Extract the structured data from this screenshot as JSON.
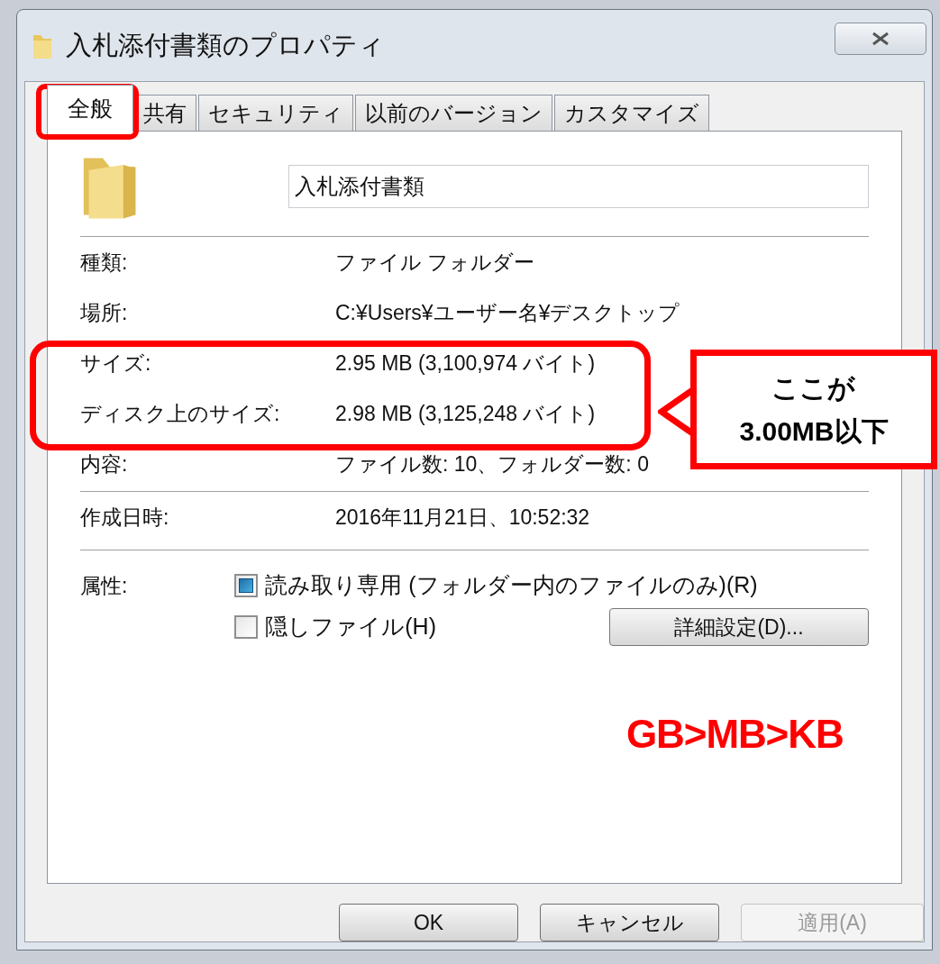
{
  "window": {
    "title": "入札添付書類のプロパティ"
  },
  "tabs": [
    {
      "label": "全般",
      "selected": true
    },
    {
      "label": "共有",
      "selected": false
    },
    {
      "label": "セキュリティ",
      "selected": false
    },
    {
      "label": "以前のバージョン",
      "selected": false
    },
    {
      "label": "カスタマイズ",
      "selected": false
    }
  ],
  "name_field": {
    "value": "入札添付書類"
  },
  "sections": [
    {
      "rows": [
        {
          "label": "種類:",
          "value": "ファイル フォルダー"
        },
        {
          "label": "場所:",
          "value": "C:¥Users¥ユーザー名¥デスクトップ"
        },
        {
          "label": "サイズ:",
          "value": "2.95 MB (3,100,974 バイト)"
        },
        {
          "label": "ディスク上のサイズ:",
          "value": "2.98 MB (3,125,248 バイト)"
        },
        {
          "label": "内容:",
          "value": "ファイル数: 10、フォルダー数: 0"
        }
      ]
    },
    {
      "rows": [
        {
          "label": "作成日時:",
          "value": "2016年11月21日、10:52:32"
        }
      ]
    }
  ],
  "attributes": {
    "label": "属性:",
    "checkboxes": [
      {
        "label": "読み取り専用 (フォルダー内のファイルのみ)(R)",
        "checked": false,
        "indeterminate": true
      },
      {
        "label": "隠しファイル(H)",
        "checked": false,
        "indeterminate": false
      }
    ],
    "advanced_button": "詳細設定(D)..."
  },
  "buttons": [
    {
      "label": "OK",
      "disabled": false
    },
    {
      "label": "キャンセル",
      "disabled": false
    },
    {
      "label": "適用(A)",
      "disabled": true
    }
  ],
  "annotations": {
    "callout": "ここが\n3.00MB以下",
    "note": "GB>MB>KB"
  }
}
